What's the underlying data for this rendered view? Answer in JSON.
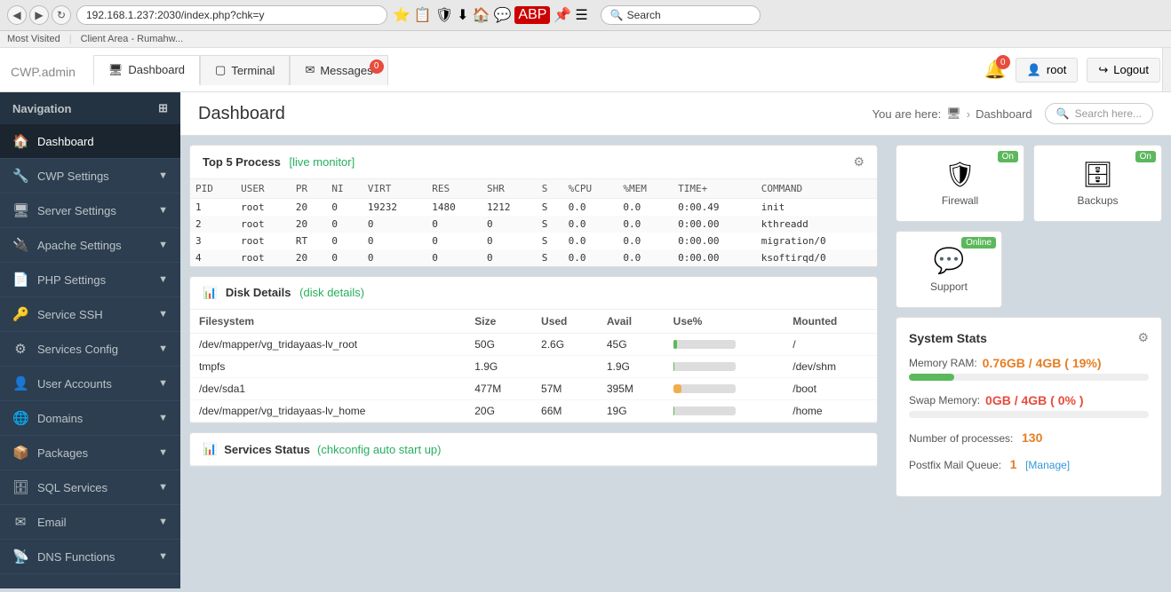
{
  "browser": {
    "url": "192.168.1.237:2030/index.php?chk=y",
    "search_placeholder": "Search",
    "back_btn": "◀",
    "forward_btn": "▶",
    "reload_btn": "↻",
    "bookmarks": [
      "Most Visited",
      "Client Area - Rumahw..."
    ]
  },
  "app": {
    "logo": "CWP",
    "logo_sub": ".admin",
    "nav_tabs": [
      {
        "label": "Dashboard",
        "icon": "🖥",
        "active": true,
        "badge": null
      },
      {
        "label": "Terminal",
        "icon": "▢",
        "active": false,
        "badge": null
      },
      {
        "label": "Messages",
        "icon": "✉",
        "active": false,
        "badge": "0"
      }
    ],
    "top_right": {
      "bell_badge": "0",
      "user_label": "root",
      "logout_label": "Logout"
    },
    "sidebar": {
      "nav_label": "Navigation",
      "items": [
        {
          "label": "Dashboard",
          "icon": "🏠",
          "has_arrow": false
        },
        {
          "label": "CWP Settings",
          "icon": "🔧",
          "has_arrow": true
        },
        {
          "label": "Server Settings",
          "icon": "🖥",
          "has_arrow": true
        },
        {
          "label": "Apache Settings",
          "icon": "🔌",
          "has_arrow": true
        },
        {
          "label": "PHP Settings",
          "icon": "📄",
          "has_arrow": true
        },
        {
          "label": "Service SSH",
          "icon": "🔑",
          "has_arrow": true
        },
        {
          "label": "Services Config",
          "icon": "⚙",
          "has_arrow": true
        },
        {
          "label": "User Accounts",
          "icon": "👤",
          "has_arrow": true
        },
        {
          "label": "Domains",
          "icon": "🌐",
          "has_arrow": true
        },
        {
          "label": "Packages",
          "icon": "📦",
          "has_arrow": true
        },
        {
          "label": "SQL Services",
          "icon": "🗄",
          "has_arrow": true
        },
        {
          "label": "Email",
          "icon": "✉",
          "has_arrow": true
        },
        {
          "label": "DNS Functions",
          "icon": "📡",
          "has_arrow": true
        }
      ]
    },
    "dashboard": {
      "title": "Dashboard",
      "breadcrumb_label": "You are here:",
      "breadcrumb_home": "🖥",
      "breadcrumb_current": "Dashboard",
      "search_placeholder": "Search here...",
      "top5_title": "Top 5 Process",
      "live_monitor_label": "[live monitor]",
      "process_table": {
        "headers": [
          "PID",
          "USER",
          "PR",
          "NI",
          "VIRT",
          "RES",
          "SHR",
          "S",
          "%CPU",
          "%MEM",
          "TIME+",
          "COMMAND"
        ],
        "rows": [
          [
            "1",
            "root",
            "20",
            "0",
            "19232",
            "1480",
            "1212",
            "S",
            "0.0",
            "0.0",
            "0:00.49",
            "init"
          ],
          [
            "2",
            "root",
            "20",
            "0",
            "0",
            "0",
            "0",
            "S",
            "0.0",
            "0.0",
            "0:00.00",
            "kthreadd"
          ],
          [
            "3",
            "root",
            "RT",
            "0",
            "0",
            "0",
            "0",
            "S",
            "0.0",
            "0.0",
            "0:00.00",
            "migration/0"
          ],
          [
            "4",
            "root",
            "20",
            "0",
            "0",
            "0",
            "0",
            "S",
            "0.0",
            "0.0",
            "0:00.00",
            "ksoftirqd/0"
          ]
        ]
      },
      "disk_title": "Disk Details",
      "disk_link": "(disk details)",
      "disk_table": {
        "headers": [
          "Filesystem",
          "Size",
          "Used",
          "Avail",
          "Use%",
          "Mounted"
        ],
        "rows": [
          [
            "/dev/mapper/vg_tridayaas-lv_root",
            "50G",
            "2.6G",
            "45G",
            "6%",
            "/"
          ],
          [
            "tmpfs",
            "1.9G",
            "",
            "1.9G",
            "0%",
            "/dev/shm"
          ],
          [
            "/dev/sda1",
            "477M",
            "57M",
            "395M",
            "13%",
            "/boot"
          ],
          [
            "/dev/mapper/vg_tridayaas-lv_home",
            "20G",
            "66M",
            "19G",
            "1%",
            "/home"
          ]
        ]
      },
      "services_status_title": "Services Status",
      "services_link": "(chkconfig auto start up)",
      "status_cards": [
        {
          "label": "Firewall",
          "icon": "🛡",
          "status": "On",
          "status_color": "#5cb85c"
        },
        {
          "label": "Backups",
          "icon": "🗄",
          "status": "On",
          "status_color": "#5cb85c"
        },
        {
          "label": "Support",
          "icon": "💬",
          "status": "Online",
          "status_color": "#5cb85c"
        }
      ],
      "system_stats": {
        "title": "System Stats",
        "memory_label": "Memory RAM:",
        "memory_value": "0.76GB / 4GB ( 19%)",
        "memory_pct": 19,
        "memory_color": "#5cb85c",
        "swap_label": "Swap Memory:",
        "swap_value": "0GB / 4GB ( 0% )",
        "swap_pct": 0,
        "swap_color": "#e74c3c",
        "processes_label": "Number of processes:",
        "processes_value": "130",
        "mail_queue_label": "Postfix Mail Queue:",
        "mail_queue_value": "1",
        "manage_label": "[Manage]"
      }
    }
  }
}
